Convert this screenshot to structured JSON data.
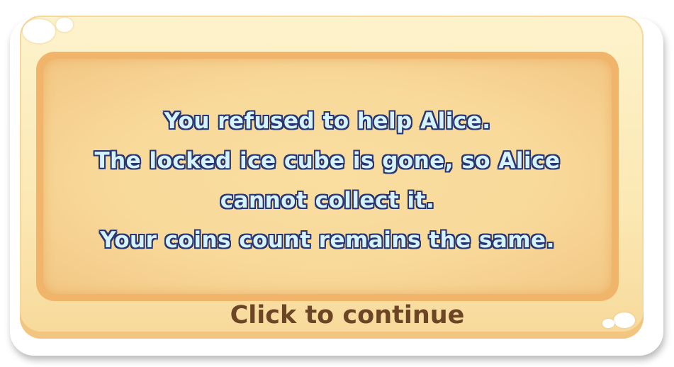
{
  "dialog": {
    "message_lines": [
      "You refused to help Alice.",
      "The locked ice cube is gone, so Alice",
      "cannot collect it.",
      "Your coins count remains the same."
    ],
    "continue_label": "Click to continue"
  },
  "colors": {
    "panel": "#fbe8b3",
    "message_border": "#f0b46b",
    "message_text": "#d4f3fb",
    "message_outline": "#2a3470",
    "continue_text": "#6b4526"
  }
}
